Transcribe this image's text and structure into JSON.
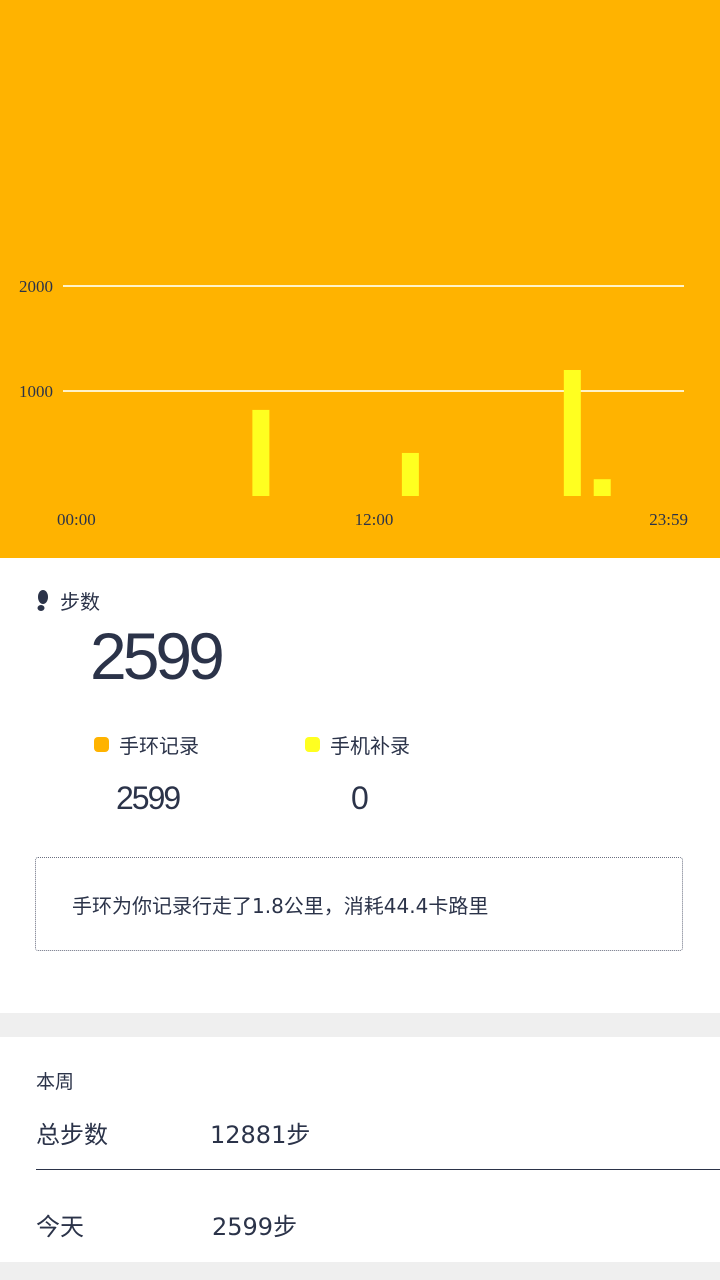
{
  "colors": {
    "chart_background": "#ffb300",
    "band_series": "#ffb300",
    "phone_series": "#ffff20",
    "text": "#2b3349"
  },
  "chart_data": {
    "type": "bar",
    "x_ticks": [
      "00:00",
      "12:00",
      "23:59"
    ],
    "y_ticks": [
      "2000",
      "1000"
    ],
    "ylim": [
      0,
      2000
    ],
    "series": [
      {
        "x_hours": [
          7.5,
          13.5,
          20.0,
          21.2
        ],
        "values": [
          820,
          410,
          1200,
          160
        ]
      }
    ],
    "grid": true
  },
  "steps": {
    "label": "步数",
    "icon": "footprint-icon",
    "total": "2599"
  },
  "legend": [
    {
      "label": "手环记录",
      "value": "2599"
    },
    {
      "label": "手机补录",
      "value": "0"
    }
  ],
  "summary": "手环为你记录行走了1.8公里，消耗44.4卡路里",
  "week": {
    "title": "本周",
    "rows": [
      {
        "label": "总步数",
        "value": "12881步"
      },
      {
        "label": "今天",
        "value": "2599步"
      }
    ]
  }
}
